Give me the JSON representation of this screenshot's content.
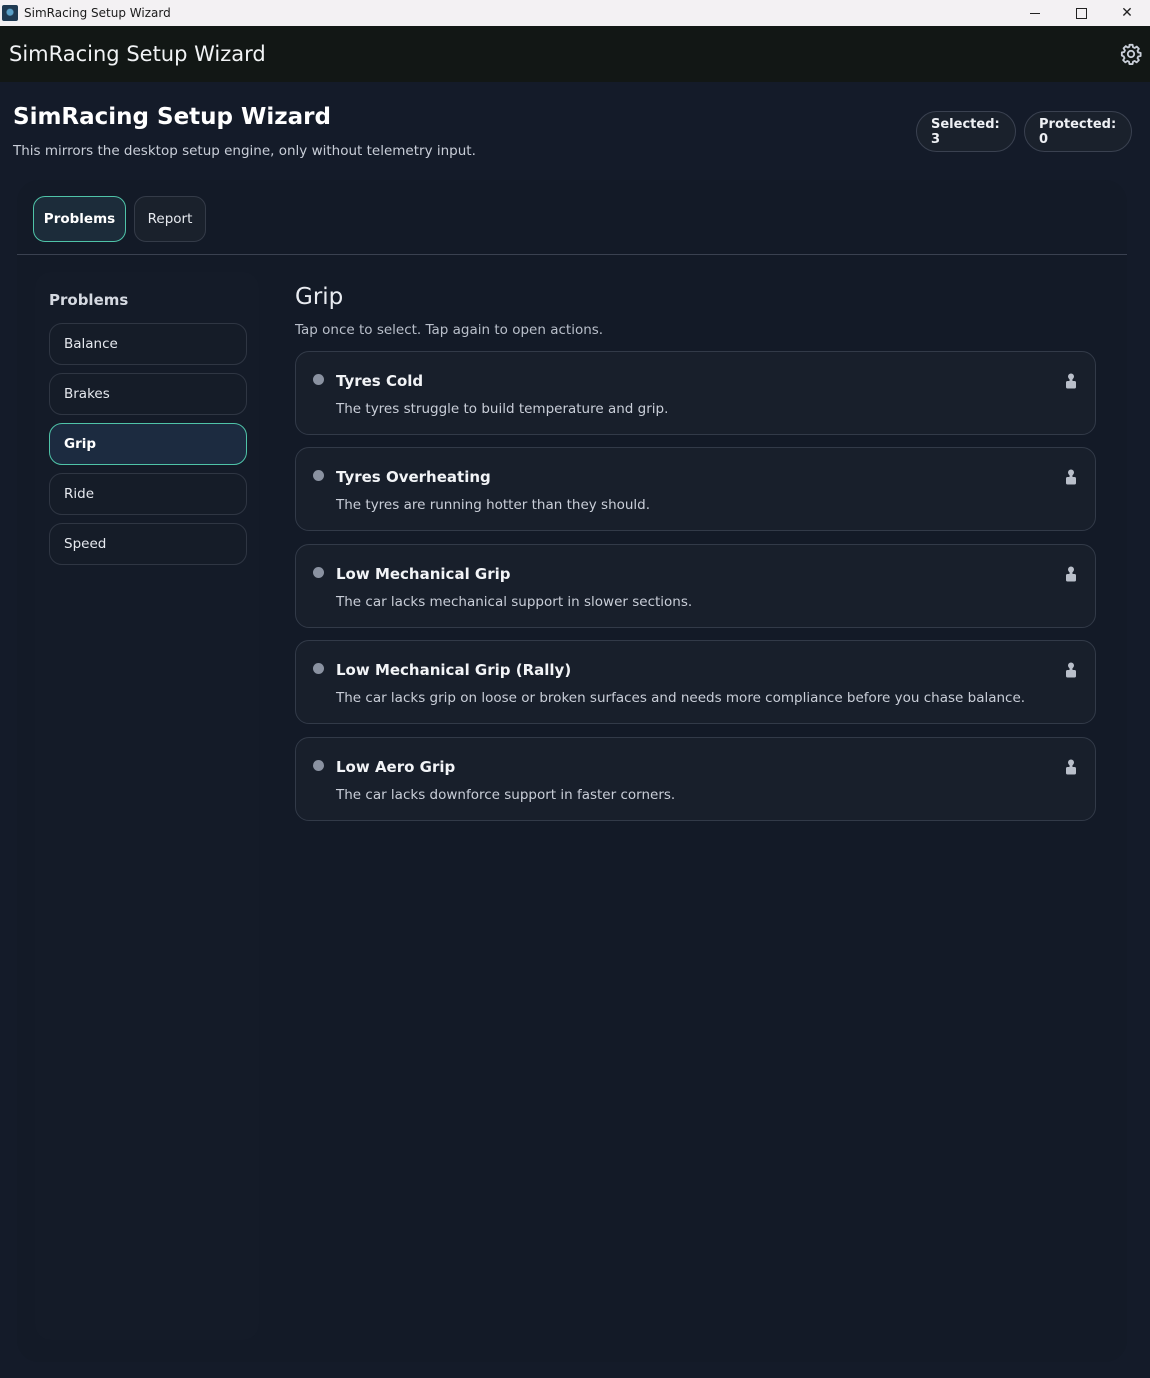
{
  "window": {
    "title": "SimRacing Setup Wizard",
    "controls": {
      "minimize": "",
      "maximize": "",
      "close": "✕"
    }
  },
  "app_header": {
    "title": "SimRacing Setup Wizard",
    "settings_icon": "gear-icon"
  },
  "page": {
    "title": "SimRacing Setup Wizard",
    "subtitle": "This mirrors the desktop setup engine, only without telemetry input.",
    "badges": {
      "selected": "Selected: 3",
      "protected": "Protected: 0"
    }
  },
  "tabs": [
    {
      "label": "Problems",
      "active": true
    },
    {
      "label": "Report",
      "active": false
    }
  ],
  "sidebar": {
    "heading": "Problems",
    "items": [
      {
        "label": "Balance",
        "active": false
      },
      {
        "label": "Brakes",
        "active": false
      },
      {
        "label": "Grip",
        "active": true
      },
      {
        "label": "Ride",
        "active": false
      },
      {
        "label": "Speed",
        "active": false
      }
    ]
  },
  "content": {
    "title": "Grip",
    "subtitle": "Tap once to select. Tap again to open actions.",
    "problems": [
      {
        "title": "Tyres Cold",
        "description": "The tyres struggle to build temperature and grip.",
        "icon": "lock-icon"
      },
      {
        "title": "Tyres Overheating",
        "description": "The tyres are running hotter than they should.",
        "icon": "lock-icon"
      },
      {
        "title": "Low Mechanical Grip",
        "description": "The car lacks mechanical support in slower sections.",
        "icon": "lock-icon"
      },
      {
        "title": "Low Mechanical Grip (Rally)",
        "description": "The car lacks grip on loose or broken surfaces and needs more compliance before you chase balance.",
        "icon": "lock-icon"
      },
      {
        "title": "Low Aero Grip",
        "description": "The car lacks downforce support in faster corners.",
        "icon": "lock-icon"
      }
    ]
  },
  "colors": {
    "background": "#141b29",
    "accent": "#4fc3a8",
    "header_bar": "#121715",
    "card": "#181f2b"
  }
}
